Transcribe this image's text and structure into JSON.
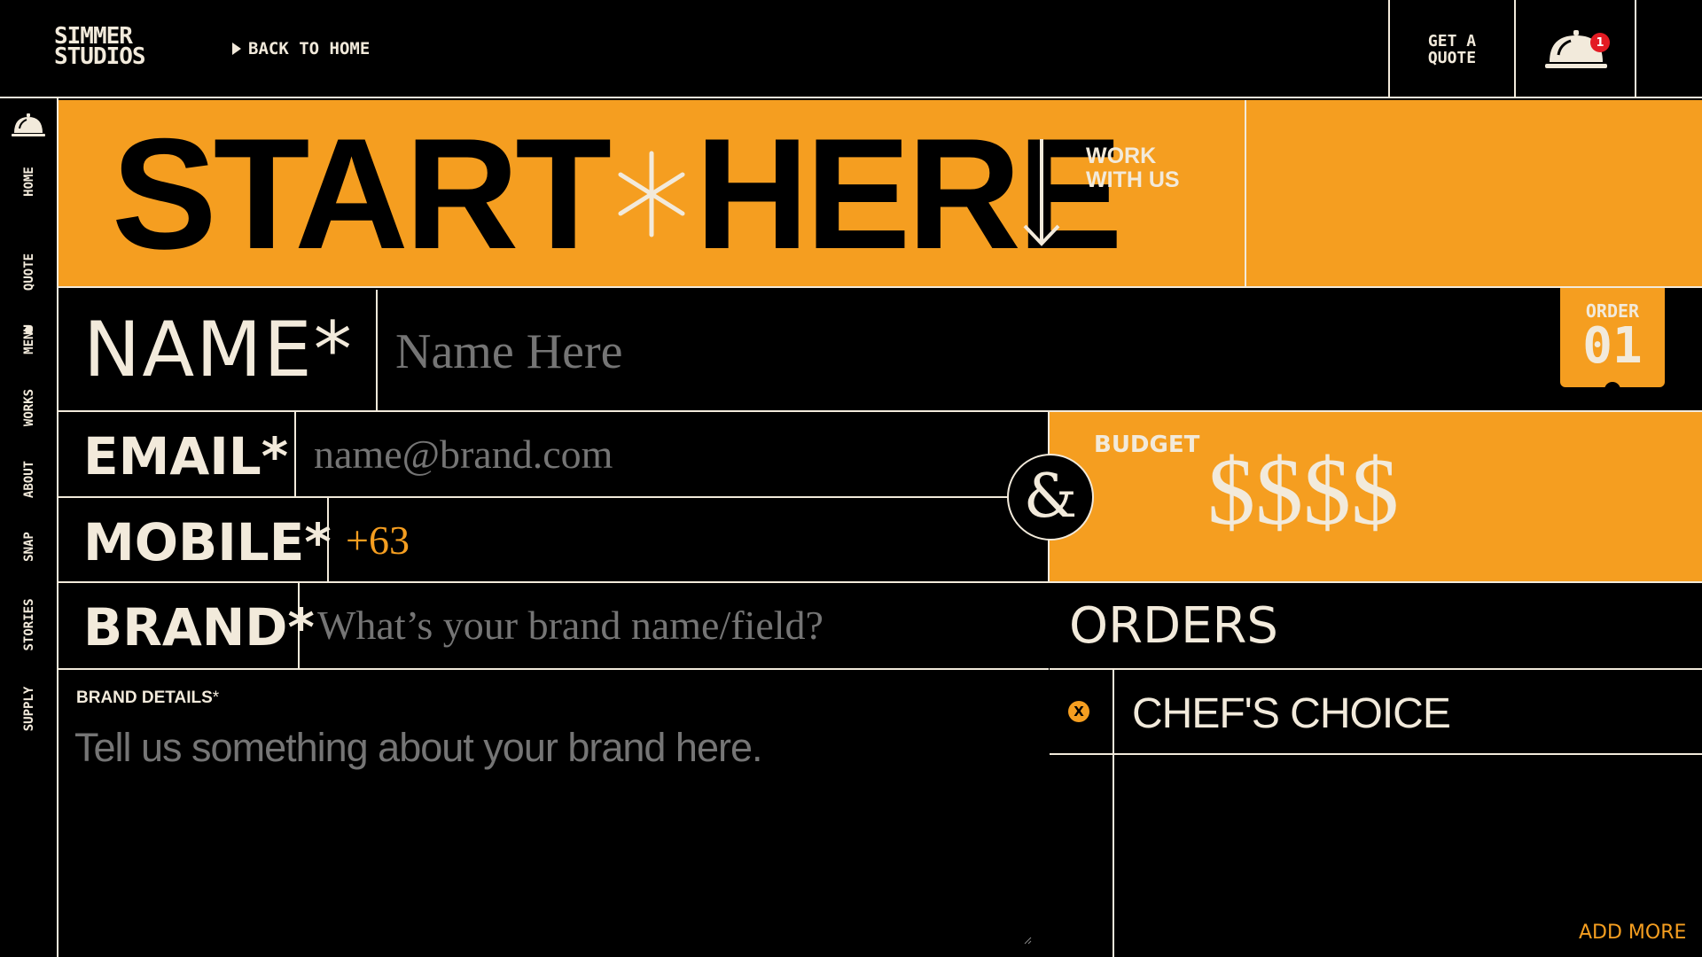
{
  "brand": {
    "line1": "SIMMER",
    "line2": "STUDIOS"
  },
  "nav": {
    "back_label": "BACK TO HOME"
  },
  "header": {
    "quote_line1": "GET A",
    "quote_line2": "QUOTE",
    "cart_count": "1"
  },
  "sidebar": {
    "items": [
      "HOME",
      "QUOTE",
      "MENU",
      "WORKS",
      "ABOUT",
      "SNAP",
      "STORIES",
      "SUPPLY"
    ]
  },
  "hero": {
    "title_left": "START",
    "title_right": "HERE",
    "sub_line1": "WORK",
    "sub_line2": "WITH US"
  },
  "form": {
    "name_label": "NAME*",
    "name_placeholder": "Name Here",
    "email_label": "EMAIL*",
    "email_placeholder": "name@brand.com",
    "mobile_label": "MOBILE*",
    "mobile_value": "+63",
    "brand_label": "BRAND*",
    "brand_placeholder": "What’s your brand name/field?",
    "details_label": "BRAND DETAILS",
    "details_required": "*",
    "details_placeholder": "Tell us something about your brand here."
  },
  "order_tab": {
    "label": "ORDER",
    "number": "01"
  },
  "budget": {
    "label": "BUDGET",
    "value": "$$$$",
    "connector": "&"
  },
  "orders": {
    "title": "ORDERS",
    "items": [
      {
        "label": "CHEF'S CHOICE",
        "remove": "X"
      }
    ],
    "add_more": "ADD MORE"
  },
  "colors": {
    "orange": "#f59e20",
    "cream": "#f2eadb",
    "black": "#000000",
    "badge": "#e31b23"
  }
}
